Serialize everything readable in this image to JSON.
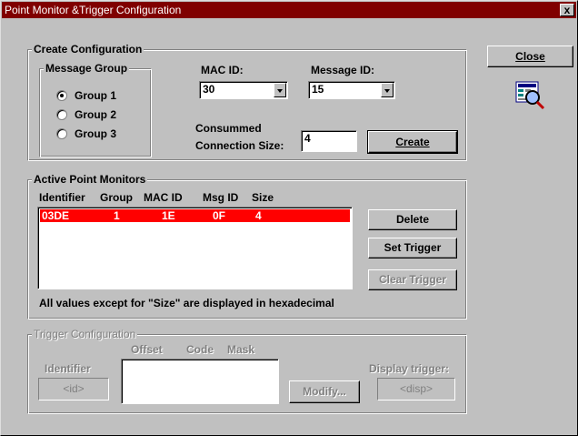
{
  "window": {
    "title": "Point Monitor &Trigger Configuration",
    "close_glyph": "x"
  },
  "create_config": {
    "legend": "Create Configuration",
    "message_group": {
      "legend": "Message Group",
      "options": [
        "Group 1",
        "Group 2",
        "Group 3"
      ],
      "selected": "Group 1"
    },
    "mac_id": {
      "label": "MAC ID:",
      "value": "30"
    },
    "message_id": {
      "label": "Message ID:",
      "value": "15"
    },
    "conn_size": {
      "label_line1": "Consummed",
      "label_line2": "Connection Size:",
      "value": "4"
    },
    "create_button": "Create"
  },
  "active_monitors": {
    "legend": "Active Point Monitors",
    "columns": [
      "Identifier",
      "Group",
      "MAC ID",
      "Msg ID",
      "Size"
    ],
    "rows": [
      {
        "identifier": "03DE",
        "group": "1",
        "mac_id": "1E",
        "msg_id": "0F",
        "size": "4",
        "selected": true
      }
    ],
    "note": "All values except for \"Size\" are displayed in hexadecimal",
    "delete_button": "Delete",
    "set_trigger_button": "Set Trigger",
    "clear_trigger_button": "Clear Trigger"
  },
  "trigger_config": {
    "legend": "Trigger Configuration",
    "identifier_label": "Identifier",
    "identifier_value": "<id>",
    "columns": [
      "Offset",
      "Code",
      "Mask"
    ],
    "modify_button": "Modify...",
    "display_trigger_label": "Display trigger:",
    "display_trigger_value": "<disp>"
  },
  "close_button": "Close",
  "icons": {
    "monitor": "monitor-magnifier-icon"
  }
}
